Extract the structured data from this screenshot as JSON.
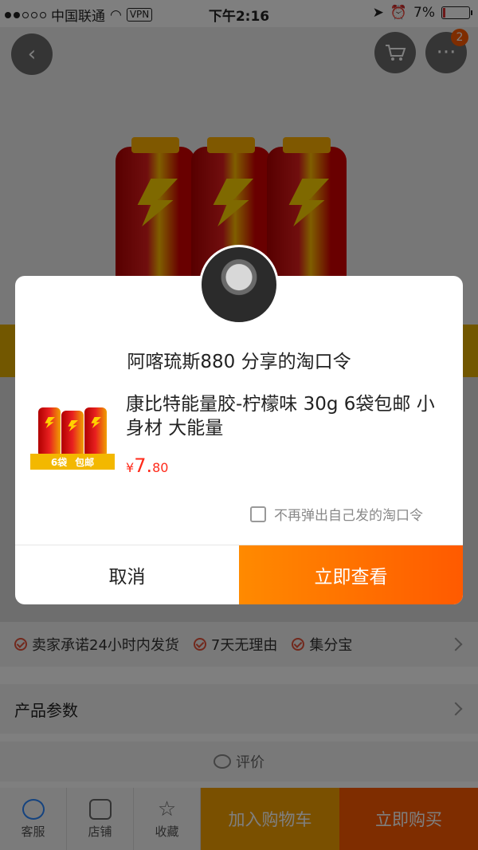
{
  "status_bar": {
    "carrier": "中国联通",
    "vpn": "VPN",
    "time": "下午2:16",
    "battery": "7%"
  },
  "top_nav": {
    "back_icon": "chevron-left-icon",
    "cart_icon": "cart-icon",
    "more_icon": "more-icon",
    "more_badge": "2"
  },
  "service_promises": {
    "items": [
      "卖家承诺24小时内发货",
      "7天无理由",
      "集分宝"
    ]
  },
  "product_params": {
    "label": "产品参数"
  },
  "review_section": {
    "label": "评价"
  },
  "bottom_bar": {
    "service_label": "客服",
    "shop_label": "店铺",
    "favorite_label": "收藏",
    "add_cart_label": "加入购物车",
    "buy_now_label": "立即购买"
  },
  "share_dialog": {
    "title": "阿喀琉斯880 分享的淘口令",
    "product_title": "康比特能量胶-柠檬味 30g  6袋包邮  小身材 大能量",
    "thumb_text_left": "6袋",
    "thumb_text_right": "包邮",
    "price_symbol": "¥",
    "price_integer": "7.",
    "price_decimal": "80",
    "checkbox_label": "不再弹出自己发的淘口令",
    "cancel_label": "取消",
    "view_label": "立即查看"
  },
  "colors": {
    "accent_orange": "#ff5a00",
    "cart_yellow": "#f5a000",
    "price_red": "#ff2a1a"
  }
}
